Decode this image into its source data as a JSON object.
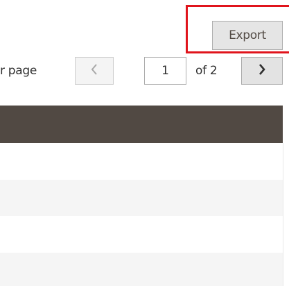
{
  "toolbar": {
    "export_label": "Export"
  },
  "pagination": {
    "per_page_label": "r page",
    "current_page": "1",
    "of_pages": "of 2",
    "prev_icon": "chevron-left-icon",
    "next_icon": "chevron-right-icon"
  },
  "colors": {
    "highlight": "#e0141c",
    "header_bg": "#514943",
    "row_alt": "#f5f5f5"
  }
}
